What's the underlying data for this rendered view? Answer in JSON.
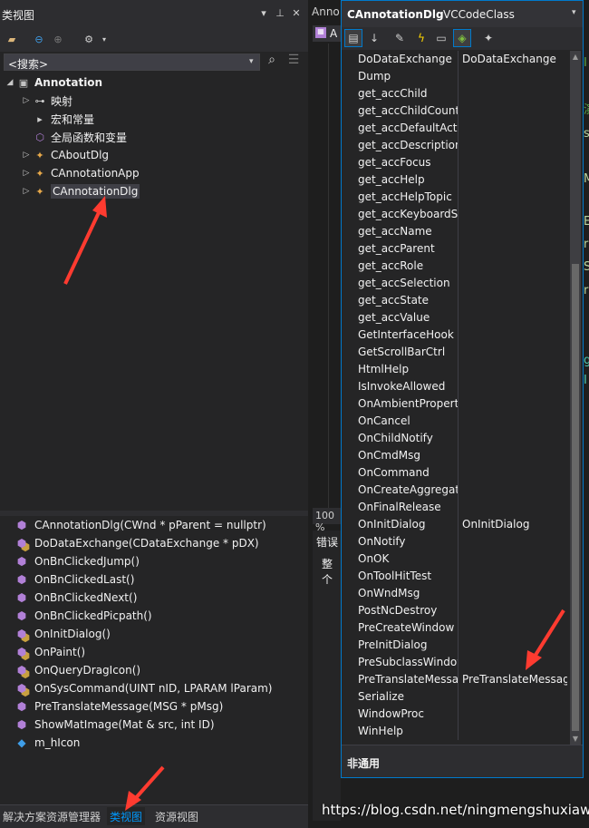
{
  "class_view": {
    "title": "类视图",
    "search_text": "<搜索>",
    "tree": [
      {
        "label": "Annotation",
        "bold": true,
        "arrow": "◢",
        "icon": "project-icon",
        "indent": 0
      },
      {
        "label": "映射",
        "arrow": "▷",
        "icon": "map-icon",
        "indent": 1
      },
      {
        "label": "宏和常量",
        "arrow": "",
        "icon": "macro-icon",
        "indent": 1
      },
      {
        "label": "全局函数和变量",
        "arrow": "",
        "icon": "global-icon",
        "indent": 1
      },
      {
        "label": "CAboutDlg",
        "arrow": "▷",
        "icon": "class-icon",
        "indent": 1
      },
      {
        "label": "CAnnotationApp",
        "arrow": "▷",
        "icon": "class-icon",
        "indent": 1
      },
      {
        "label": "CAnnotationDlg",
        "arrow": "▷",
        "icon": "class-icon",
        "indent": 1,
        "selected": true
      }
    ],
    "members": [
      {
        "label": "CAnnotationDlg(CWnd * pParent = nullptr)",
        "icon": "public-method-icon"
      },
      {
        "label": "DoDataExchange(CDataExchange * pDX)",
        "icon": "protected-method-icon"
      },
      {
        "label": "OnBnClickedJump()",
        "icon": "public-method-icon"
      },
      {
        "label": "OnBnClickedLast()",
        "icon": "public-method-icon"
      },
      {
        "label": "OnBnClickedNext()",
        "icon": "public-method-icon"
      },
      {
        "label": "OnBnClickedPicpath()",
        "icon": "public-method-icon"
      },
      {
        "label": "OnInitDialog()",
        "icon": "protected-method-icon"
      },
      {
        "label": "OnPaint()",
        "icon": "protected-method-icon"
      },
      {
        "label": "OnQueryDragIcon()",
        "icon": "protected-method-icon"
      },
      {
        "label": "OnSysCommand(UINT nID, LPARAM lParam)",
        "icon": "protected-method-icon"
      },
      {
        "label": "PreTranslateMessage(MSG * pMsg)",
        "icon": "public-method-icon"
      },
      {
        "label": "ShowMatImage(Mat & src, int ID)",
        "icon": "public-method-icon"
      },
      {
        "label": "m_hIcon",
        "icon": "field-icon"
      }
    ],
    "bottom_tabs": [
      "解决方案资源管理器",
      "类视图",
      "资源视图"
    ],
    "active_tab": 1
  },
  "editor": {
    "tab_label": "Anno",
    "strip_label": "A",
    "zoom": "100 %",
    "err_title": "错误",
    "err_sub": "整个"
  },
  "properties": {
    "object_name": "CAnnotationDlg",
    "object_type": "VCCodeClass",
    "rows": [
      {
        "name": "DoDataExchange",
        "value": "DoDataExchange"
      },
      {
        "name": "Dump",
        "value": ""
      },
      {
        "name": "get_accChild",
        "value": ""
      },
      {
        "name": "get_accChildCount",
        "value": ""
      },
      {
        "name": "get_accDefaultAction",
        "value": ""
      },
      {
        "name": "get_accDescription",
        "value": ""
      },
      {
        "name": "get_accFocus",
        "value": ""
      },
      {
        "name": "get_accHelp",
        "value": ""
      },
      {
        "name": "get_accHelpTopic",
        "value": ""
      },
      {
        "name": "get_accKeyboardShortcut",
        "value": ""
      },
      {
        "name": "get_accName",
        "value": ""
      },
      {
        "name": "get_accParent",
        "value": ""
      },
      {
        "name": "get_accRole",
        "value": ""
      },
      {
        "name": "get_accSelection",
        "value": ""
      },
      {
        "name": "get_accState",
        "value": ""
      },
      {
        "name": "get_accValue",
        "value": ""
      },
      {
        "name": "GetInterfaceHook",
        "value": ""
      },
      {
        "name": "GetScrollBarCtrl",
        "value": ""
      },
      {
        "name": "HtmlHelp",
        "value": ""
      },
      {
        "name": "IsInvokeAllowed",
        "value": ""
      },
      {
        "name": "OnAmbientProperty",
        "value": ""
      },
      {
        "name": "OnCancel",
        "value": ""
      },
      {
        "name": "OnChildNotify",
        "value": ""
      },
      {
        "name": "OnCmdMsg",
        "value": ""
      },
      {
        "name": "OnCommand",
        "value": ""
      },
      {
        "name": "OnCreateAggregates",
        "value": ""
      },
      {
        "name": "OnFinalRelease",
        "value": ""
      },
      {
        "name": "OnInitDialog",
        "value": "OnInitDialog"
      },
      {
        "name": "OnNotify",
        "value": ""
      },
      {
        "name": "OnOK",
        "value": ""
      },
      {
        "name": "OnToolHitTest",
        "value": ""
      },
      {
        "name": "OnWndMsg",
        "value": ""
      },
      {
        "name": "PostNcDestroy",
        "value": ""
      },
      {
        "name": "PreCreateWindow",
        "value": ""
      },
      {
        "name": "PreInitDialog",
        "value": ""
      },
      {
        "name": "PreSubclassWindow",
        "value": ""
      },
      {
        "name": "PreTranslateMessage",
        "value": "PreTranslateMessage"
      },
      {
        "name": "Serialize",
        "value": ""
      },
      {
        "name": "WindowProc",
        "value": ""
      },
      {
        "name": "WinHelp",
        "value": ""
      }
    ],
    "description": "非通用"
  },
  "right_edge_glyphs": [
    "I",
    "演",
    "s",
    "M",
    "E",
    "r",
    "S",
    "r",
    "g",
    "I"
  ],
  "watermark": "https://blog.csdn.net/ningmengshuxiawo",
  "colors": {
    "accent": "#007acc",
    "annotation_arrow": "#ff3b30",
    "active_tab": "#0097fb"
  }
}
